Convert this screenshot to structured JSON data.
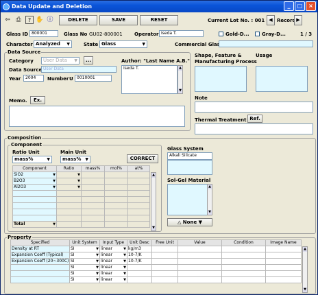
{
  "window": {
    "title": "Data Update and Deletion"
  },
  "toolbar": {
    "delete_label": "DELETE",
    "save_label": "SAVE",
    "reset_label": "RESET",
    "current_lot_label": "Current Lot No. : 001",
    "record_label": "Record"
  },
  "header": {
    "glass_id_label": "Glass ID",
    "glass_id_value": "800001",
    "glass_no_label": "Glass No",
    "glass_no_value": "GU02-800001",
    "operator_label": "Operator",
    "operator_value": "Iseda T.",
    "gold_label": "Gold-D...",
    "gray_label": "Gray-D...",
    "page": "1 / 3",
    "character_label": "Character",
    "character_value": "Analyzed",
    "state_label": "State",
    "state_value": "Glass",
    "commercial_label": "Commercial Glass"
  },
  "datasource": {
    "title": "Data Source",
    "category_label": "Category",
    "category_value": "User Data",
    "ellipsis": "...",
    "author_label": "Author: \"Last Name A.B.\"",
    "author_value": "Iseda T.",
    "ds_label": "Data Source",
    "ds_value": "User Data",
    "year_label": "Year",
    "year_value": "2004",
    "number_label": "Number",
    "number_prefix": "U",
    "number_value": "0010001",
    "memo_label": "Memo.",
    "ex_label": "Ex."
  },
  "right_panel": {
    "shape_label": "Shape, Feature &",
    "shape_label2": "Manufacturing Process",
    "usage_label": "Usage",
    "note_label": "Note",
    "thermal_label": "Thermal Treatment",
    "ref_label": "Ref."
  },
  "composition": {
    "title": "Composition",
    "component_title": "Component",
    "ratio_unit_label": "Ratio Unit",
    "ratio_unit_value": "mass%",
    "main_unit_label": "Main Unit",
    "main_unit_value": "mass%",
    "correct_label": "CORRECT",
    "columns": [
      "Component",
      "Ratio",
      "mass%",
      "mol%",
      "at%"
    ],
    "rows": [
      "SiO2",
      "B2O3",
      "Al2O3",
      "",
      "",
      "",
      "",
      ""
    ],
    "total_label": "Total",
    "glass_system_label": "Glass System",
    "glass_system_value": "Alkali Silicate",
    "solgel_label": "Sol-Gel Material",
    "none_label": "None"
  },
  "property": {
    "title": "Property",
    "columns": [
      "Specified",
      "Unit System",
      "Input Type",
      "Unit Desc",
      "Free Unit",
      "Value",
      "Condition",
      "Image Name"
    ],
    "rows": [
      {
        "specified": "Density at RT",
        "unit": "SI",
        "input": "linear",
        "desc": "kg/m3"
      },
      {
        "specified": "Expansion Coeff (Typical)",
        "unit": "SI",
        "input": "linear",
        "desc": "10-7/K"
      },
      {
        "specified": "Expansion Coeff (20~300C)",
        "unit": "SI",
        "input": "linear",
        "desc": "10-7/K"
      },
      {
        "specified": "",
        "unit": "SI",
        "input": "linear",
        "desc": ""
      },
      {
        "specified": "",
        "unit": "SI",
        "input": "linear",
        "desc": ""
      },
      {
        "specified": "",
        "unit": "SI",
        "input": "linear",
        "desc": ""
      }
    ]
  }
}
